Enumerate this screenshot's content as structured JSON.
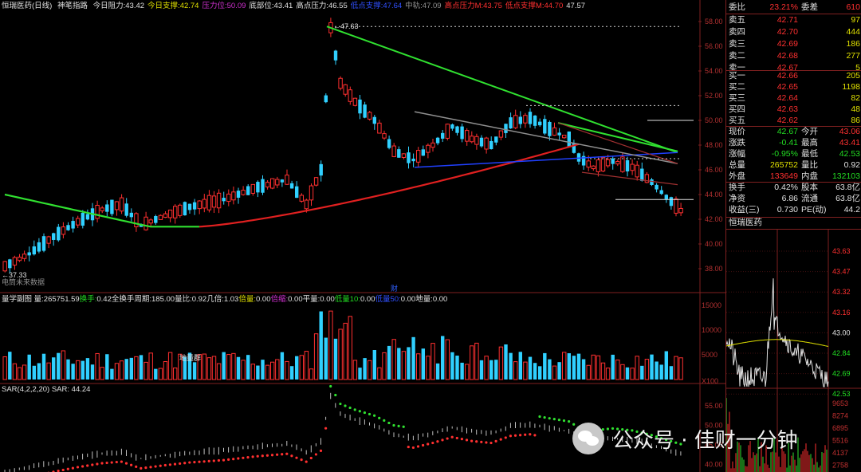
{
  "header": {
    "stock_name": "恒瑞医药(日线)",
    "indicator_name": "神笔指路",
    "items": [
      {
        "label": "今日阻力:",
        "value": "43.42",
        "color": "#e0e0e0"
      },
      {
        "label": "今日支撑:",
        "value": "42.74",
        "color": "#e0e000"
      },
      {
        "label": "压力位:",
        "value": "50.09",
        "color": "#d030d0"
      },
      {
        "label": "底部位:",
        "value": "43.41",
        "color": "#e0e0e0"
      },
      {
        "label": "高点压力:",
        "value": "46.55",
        "color": "#e0e0e0"
      },
      {
        "label": "低点支撑:",
        "value": "47.64",
        "color": "#3050ff"
      },
      {
        "label": "中轨:",
        "value": "47.09",
        "color": "#909090"
      },
      {
        "label": "高点压力M:",
        "value": "43.75",
        "color": "#ff3030"
      },
      {
        "label": "低点支撑M:",
        "value": "44.70",
        "color": "#ff3030"
      },
      {
        "label": "",
        "value": "47.57",
        "color": "#e0e0e0"
      }
    ]
  },
  "main_chart": {
    "price_ticks": [
      "58.00",
      "56.00",
      "54.00",
      "52.00",
      "50.00",
      "48.00",
      "46.00",
      "44.00",
      "42.00",
      "40.00",
      "38.00"
    ],
    "high_label": "47.63",
    "low_label": "37.33",
    "bottom_label": "电筒未来数据",
    "cai_label": "财"
  },
  "volume_panel": {
    "title": "量学副图",
    "items": [
      {
        "label": "量:",
        "value": "265751.59",
        "color": "#e0e0e0"
      },
      {
        "label": "换手:",
        "value": "0.42",
        "color": "#22dd22"
      },
      {
        "label": "全换手周期:",
        "value": "185.00",
        "color": "#e0e0e0"
      },
      {
        "label": "量比:",
        "value": "0.92",
        "color": "#e0e0e0"
      },
      {
        "label": "几倍:",
        "value": "1.03",
        "color": "#e0e0e0"
      },
      {
        "label": "倍量:",
        "value": "0.00",
        "color": "#e0e000"
      },
      {
        "label": "倍缩:",
        "value": "0.00",
        "color": "#d030d0"
      },
      {
        "label": "平量:",
        "value": "0.00",
        "color": "#e0e0e0"
      },
      {
        "label": "低量10:",
        "value": "0.00",
        "color": "#22dd22"
      },
      {
        "label": "低量50:",
        "value": "0.00",
        "color": "#3050ff"
      },
      {
        "label": "地量:",
        "value": "0.00",
        "color": "#e0e0e0"
      }
    ],
    "ticks": [
      "15000",
      "10000",
      "5000",
      "X100"
    ],
    "annotation": "地量群"
  },
  "sar_panel": {
    "title": "SAR(4,2,2,20)",
    "label": "SAR:",
    "value": "44.24",
    "ticks": [
      "55.00",
      "50.00",
      "45.00",
      "40.00"
    ]
  },
  "quote": {
    "weibi_label": "委比",
    "weibi_value": "23.21%",
    "weicha_label": "委差",
    "weicha_value": "610",
    "asks": [
      {
        "label": "卖五",
        "price": "42.71",
        "vol": "97"
      },
      {
        "label": "卖四",
        "price": "42.70",
        "vol": "444"
      },
      {
        "label": "卖三",
        "price": "42.69",
        "vol": "186"
      },
      {
        "label": "卖二",
        "price": "42.68",
        "vol": "277"
      },
      {
        "label": "卖一",
        "price": "42.67",
        "vol": "5"
      }
    ],
    "bids": [
      {
        "label": "买一",
        "price": "42.66",
        "vol": "205"
      },
      {
        "label": "买二",
        "price": "42.65",
        "vol": "1198"
      },
      {
        "label": "买三",
        "price": "42.64",
        "vol": "82"
      },
      {
        "label": "买四",
        "price": "42.63",
        "vol": "48"
      },
      {
        "label": "买五",
        "price": "42.62",
        "vol": "86"
      }
    ],
    "stats": [
      {
        "l1": "现价",
        "v1": "42.67",
        "c1": "green",
        "l2": "今开",
        "v2": "43.06",
        "c2": "red"
      },
      {
        "l1": "涨跌",
        "v1": "-0.41",
        "c1": "green",
        "l2": "最高",
        "v2": "43.41",
        "c2": "red"
      },
      {
        "l1": "涨幅",
        "v1": "-0.95%",
        "c1": "green",
        "l2": "最低",
        "v2": "42.53",
        "c2": "green"
      },
      {
        "l1": "总量",
        "v1": "265752",
        "c1": "yellow",
        "l2": "量比",
        "v2": "0.92",
        "c2": "white"
      },
      {
        "l1": "外盘",
        "v1": "133649",
        "c1": "red",
        "l2": "内盘",
        "v2": "132103",
        "c2": "green"
      }
    ],
    "stats2": [
      {
        "l1": "换手",
        "v1": "0.42%",
        "l2": "股本",
        "v2": "63.8亿"
      },
      {
        "l1": "净资",
        "v1": "6.86",
        "l2": "流通",
        "v2": "63.8亿"
      },
      {
        "l1": "收益(三)",
        "v1": "0.730",
        "l2": "PE(动)",
        "v2": "44.2"
      }
    ]
  },
  "mini_chart": {
    "title": "恒瑞医药",
    "price_ticks": [
      "43.63",
      "43.47",
      "43.32",
      "43.16",
      "43.00",
      "42.84",
      "42.69",
      "42.53"
    ],
    "vol_ticks": [
      "9653",
      "8274",
      "6895",
      "5516",
      "4137",
      "2758"
    ]
  },
  "watermark": {
    "text": "公众号 · 佳财一分钟"
  },
  "colors": {
    "up": "#ff3030",
    "down": "#30d0ff",
    "ma_red": "#e02020",
    "ma_green": "#30e030",
    "grid": "#802020"
  }
}
